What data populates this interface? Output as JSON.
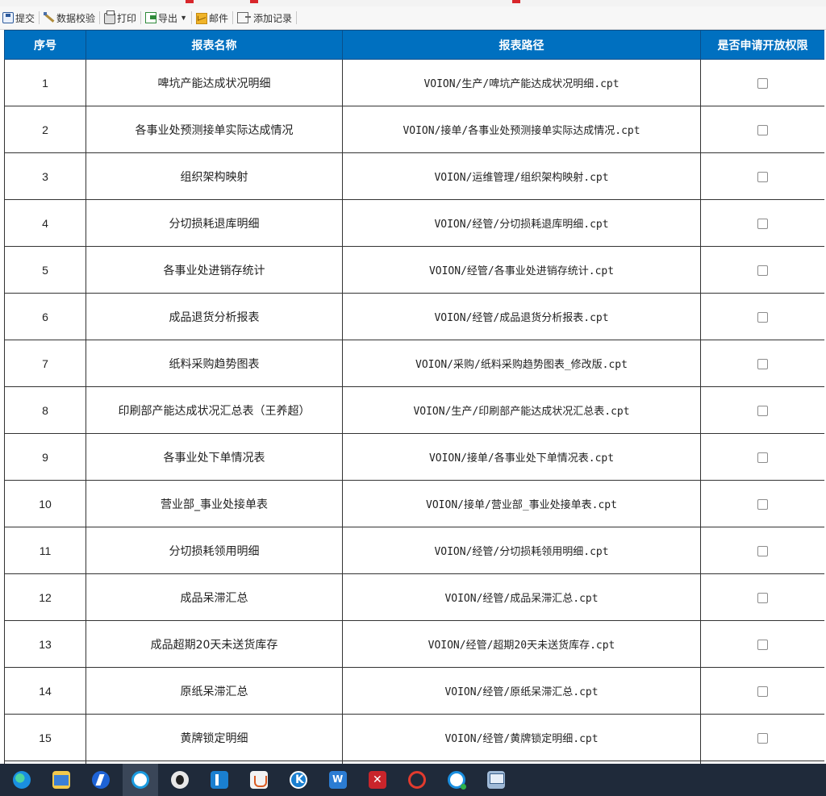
{
  "toolbar": {
    "submit": "提交",
    "validate": "数据校验",
    "print": "打印",
    "export": "导出",
    "mail": "邮件",
    "add_record": "添加记录"
  },
  "table": {
    "headers": {
      "index": "序号",
      "name": "报表名称",
      "path": "报表路径",
      "apply": "是否申请开放权限"
    },
    "rows": [
      {
        "no": "1",
        "name": "啤坑产能达成状况明细",
        "path": "VOION/生产/啤坑产能达成状况明细.cpt"
      },
      {
        "no": "2",
        "name": "各事业处预测接单实际达成情况",
        "path": "VOION/接单/各事业处预测接单实际达成情况.cpt"
      },
      {
        "no": "3",
        "name": "组织架构映射",
        "path": "VOION/运维管理/组织架构映射.cpt"
      },
      {
        "no": "4",
        "name": "分切损耗退库明细",
        "path": "VOION/经管/分切损耗退库明细.cpt"
      },
      {
        "no": "5",
        "name": "各事业处进销存统计",
        "path": "VOION/经管/各事业处进销存统计.cpt"
      },
      {
        "no": "6",
        "name": "成品退货分析报表",
        "path": "VOION/经管/成品退货分析报表.cpt"
      },
      {
        "no": "7",
        "name": "纸料采购趋势图表",
        "path": "VOION/采购/纸料采购趋势图表_修改版.cpt"
      },
      {
        "no": "8",
        "name": "印刷部产能达成状况汇总表（王养超）",
        "path": "VOION/生产/印刷部产能达成状况汇总表.cpt"
      },
      {
        "no": "9",
        "name": "各事业处下单情况表",
        "path": "VOION/接单/各事业处下单情况表.cpt"
      },
      {
        "no": "10",
        "name": "营业部_事业处接单表",
        "path": "VOION/接单/营业部_事业处接单表.cpt"
      },
      {
        "no": "11",
        "name": "分切损耗领用明细",
        "path": "VOION/经管/分切损耗领用明细.cpt"
      },
      {
        "no": "12",
        "name": "成品呆滞汇总",
        "path": "VOION/经管/成品呆滞汇总.cpt"
      },
      {
        "no": "13",
        "name": "成品超期20天未送货库存",
        "path": "VOION/经管/超期20天未送货库存.cpt"
      },
      {
        "no": "14",
        "name": "原纸呆滞汇总",
        "path": "VOION/经管/原纸呆滞汇总.cpt"
      },
      {
        "no": "15",
        "name": "黄牌锁定明细",
        "path": "VOION/经管/黄牌锁定明细.cpt"
      },
      {
        "no": "",
        "name": "",
        "path": ""
      }
    ]
  },
  "taskbar": {
    "icons": [
      "edge-icon",
      "file-explorer-icon",
      "blue-arrow-app-icon",
      "circle-browser-icon",
      "penguin-app-icon",
      "f-app-icon",
      "java-icon",
      "k-app-icon",
      "word-icon",
      "red-x-app-icon",
      "red-g-app-icon",
      "q-browser-icon",
      "remote-desktop-icon"
    ]
  },
  "colors": {
    "header_bg": "#0070c0",
    "header_text": "#ffffff",
    "taskbar_bg": "#1f2a3a"
  }
}
